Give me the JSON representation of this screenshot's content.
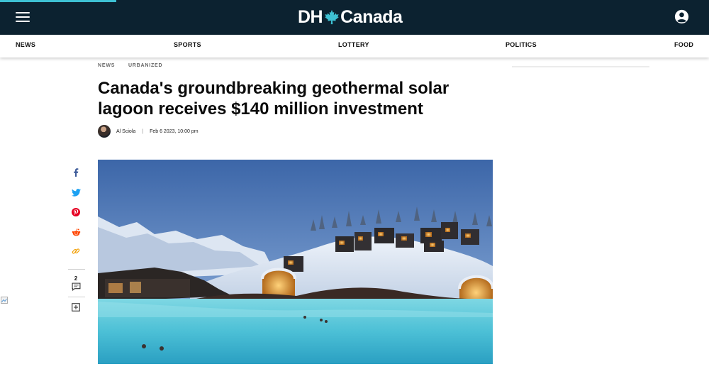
{
  "header": {
    "logo_prefix": "DH",
    "logo_suffix": "Canada",
    "menu_icon": "hamburger-menu-icon",
    "account_icon": "account-circle-icon",
    "bar_color": "#0c2230",
    "progress_color": "#3ec1d3"
  },
  "nav": {
    "items": [
      "NEWS",
      "SPORTS",
      "LOTTERY",
      "POLITICS",
      "FOOD"
    ]
  },
  "article": {
    "breadcrumbs": [
      "NEWS",
      "URBANIZED"
    ],
    "headline_line1": "Canada's groundbreaking geothermal solar",
    "headline_line2": "lagoon receives $140 million investment",
    "author": "Al Sciola",
    "date": "Feb 6 2023, 10:00 pm"
  },
  "share": {
    "icons": [
      "facebook-icon",
      "twitter-icon",
      "pinterest-icon",
      "reddit-icon",
      "copy-link-icon",
      "comment-icon",
      "add-icon"
    ],
    "comment_count": "2"
  },
  "hero": {
    "alt": "Geothermal lagoon with cabins on a snowy hill"
  }
}
